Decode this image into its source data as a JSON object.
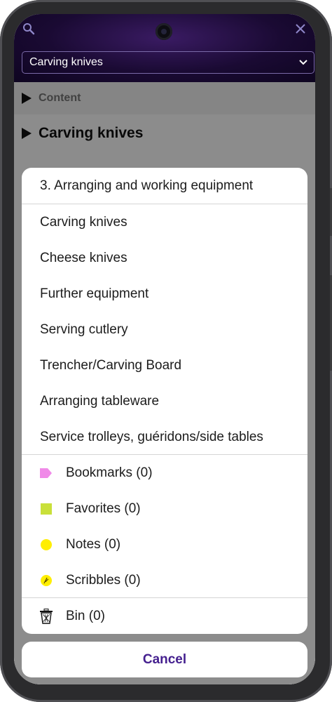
{
  "header": {
    "selector_value": "Carving knives"
  },
  "background": {
    "section_label": "Content",
    "page_heading": "Carving knives"
  },
  "sheet": {
    "section_title": "3. Arranging and working equipment",
    "items": [
      {
        "label": "Carving knives"
      },
      {
        "label": "Cheese knives"
      },
      {
        "label": "Further equipment"
      },
      {
        "label": "Serving cutlery"
      },
      {
        "label": "Trencher/Carving Board"
      },
      {
        "label": "Arranging tableware"
      },
      {
        "label": "Service trolleys, guéridons/side tables"
      }
    ],
    "collections": [
      {
        "label": "Bookmarks (0)",
        "icon": "bookmark-icon",
        "color": "#f08ae8"
      },
      {
        "label": "Favorites (0)",
        "icon": "favorite-icon",
        "color": "#c9e03a"
      },
      {
        "label": "Notes (0)",
        "icon": "note-icon",
        "color": "#ffee00"
      },
      {
        "label": "Scribbles (0)",
        "icon": "scribble-icon",
        "color": "#ffee00"
      }
    ],
    "bin_label": "Bin (0)",
    "cancel_label": "Cancel"
  },
  "colors": {
    "accent": "#45208f",
    "header_bg": "#1a0a33"
  }
}
